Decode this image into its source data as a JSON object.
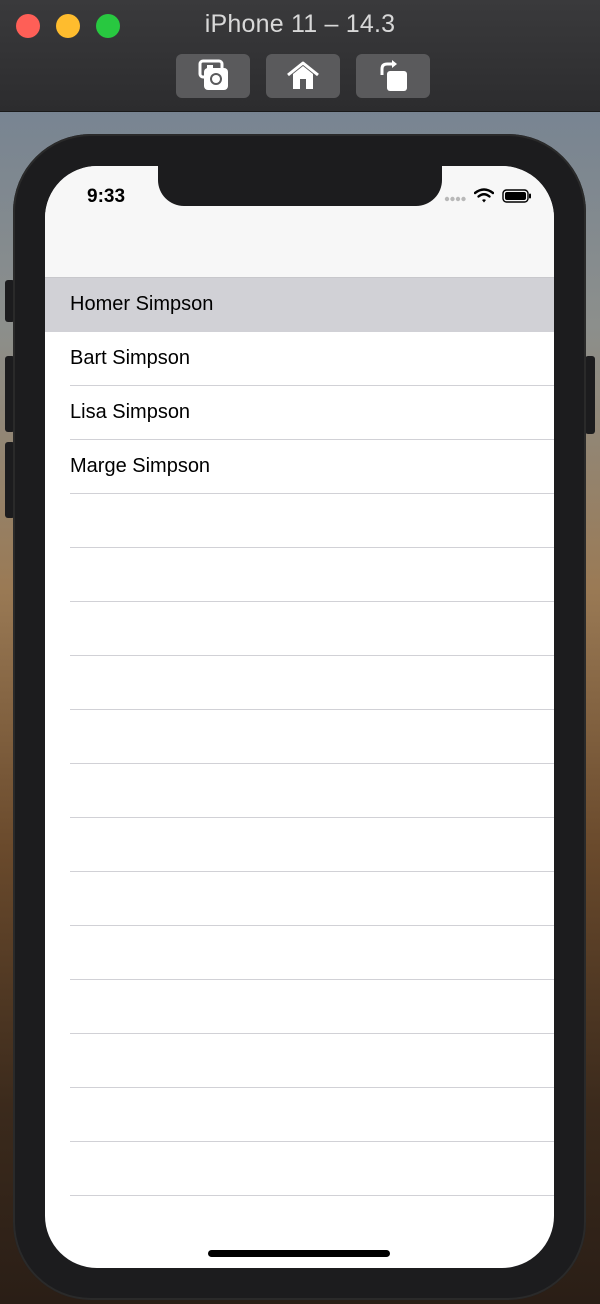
{
  "window": {
    "title": "iPhone 11 – 14.3",
    "toolbar": {
      "screenshot_icon": "camera-screenshot-icon",
      "home_icon": "home-icon",
      "rotate_icon": "rotate-icon"
    }
  },
  "status_bar": {
    "time": "9:33",
    "icons": [
      "signal-dots-icon",
      "wifi-icon",
      "battery-icon"
    ]
  },
  "table": {
    "rows": [
      {
        "label": "Homer Simpson",
        "selected": true
      },
      {
        "label": "Bart Simpson",
        "selected": false
      },
      {
        "label": "Lisa Simpson",
        "selected": false
      },
      {
        "label": "Marge Simpson",
        "selected": false
      }
    ],
    "empty_row_count": 13
  },
  "colors": {
    "selection": "#d1d1d6",
    "separator": "#d1d1d6",
    "navbar": "#f7f7f7"
  }
}
